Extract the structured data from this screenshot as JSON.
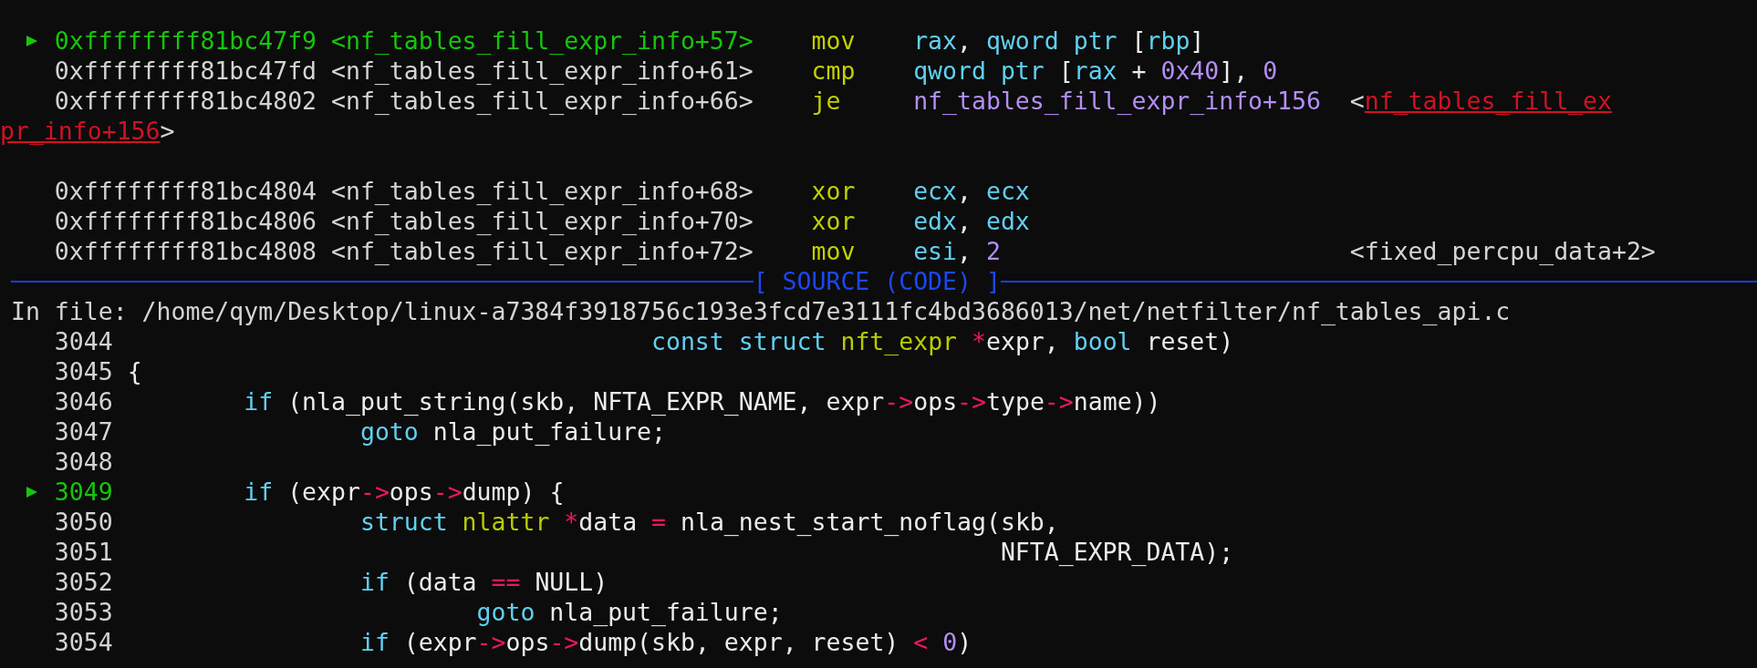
{
  "disassembly": [
    {
      "kind": "instr",
      "current": true,
      "address": "0xffffffff81bc47f9",
      "symbol": "<nf_tables_fill_expr_info+57>",
      "mnemonic": "mov",
      "operands": [
        {
          "kind": "reg",
          "text": "rax"
        },
        {
          "kind": "plain",
          "text": ", "
        },
        {
          "kind": "reg",
          "text": "qword ptr"
        },
        {
          "kind": "plain",
          "text": " ["
        },
        {
          "kind": "reg",
          "text": "rbp"
        },
        {
          "kind": "plain",
          "text": "]"
        }
      ]
    },
    {
      "kind": "instr",
      "current": false,
      "address": "0xffffffff81bc47fd",
      "symbol": "<nf_tables_fill_expr_info+61>",
      "mnemonic": "cmp",
      "operands": [
        {
          "kind": "reg",
          "text": "qword ptr"
        },
        {
          "kind": "plain",
          "text": " ["
        },
        {
          "kind": "reg",
          "text": "rax"
        },
        {
          "kind": "plain",
          "text": " + "
        },
        {
          "kind": "num",
          "text": "0x40"
        },
        {
          "kind": "plain",
          "text": "], "
        },
        {
          "kind": "num",
          "text": "0"
        }
      ]
    },
    {
      "kind": "instr",
      "current": false,
      "address": "0xffffffff81bc4802",
      "symbol": "<nf_tables_fill_expr_info+66>",
      "mnemonic": "je",
      "operands": [
        {
          "kind": "num",
          "text": "nf_tables_fill_expr_info+156"
        }
      ],
      "comment": {
        "kind": "link",
        "open": "<",
        "target": "nf_tables_fill_ex",
        "wrap": "pr_info+156",
        "close": ">"
      }
    },
    {
      "kind": "blank"
    },
    {
      "kind": "instr",
      "current": false,
      "address": "0xffffffff81bc4804",
      "symbol": "<nf_tables_fill_expr_info+68>",
      "mnemonic": "xor",
      "operands": [
        {
          "kind": "reg",
          "text": "ecx"
        },
        {
          "kind": "plain",
          "text": ", "
        },
        {
          "kind": "reg",
          "text": "ecx"
        }
      ]
    },
    {
      "kind": "instr",
      "current": false,
      "address": "0xffffffff81bc4806",
      "symbol": "<nf_tables_fill_expr_info+70>",
      "mnemonic": "xor",
      "operands": [
        {
          "kind": "reg",
          "text": "edx"
        },
        {
          "kind": "plain",
          "text": ", "
        },
        {
          "kind": "reg",
          "text": "edx"
        }
      ]
    },
    {
      "kind": "instr",
      "current": false,
      "address": "0xffffffff81bc4808",
      "symbol": "<nf_tables_fill_expr_info+72>",
      "mnemonic": "mov",
      "operands": [
        {
          "kind": "reg",
          "text": "esi"
        },
        {
          "kind": "plain",
          "text": ", "
        },
        {
          "kind": "num",
          "text": "2"
        }
      ],
      "comment": {
        "kind": "plain",
        "text": "<fixed_percpu_data+2>"
      }
    }
  ],
  "source": {
    "title": "[ SOURCE (CODE) ]",
    "file": "In file: /home/qym/Desktop/linux-a7384f3918756c193e3fcd7e3111fc4bd3686013/net/netfilter/nf_tables_api.c",
    "lines": [
      {
        "number": "3044",
        "current": false,
        "tokens": [
          {
            "kind": "kw",
            "text": "                                    const struct "
          },
          {
            "kind": "type",
            "text": "nft_expr "
          },
          {
            "kind": "op",
            "text": "*"
          },
          {
            "kind": "plain",
            "text": "expr, "
          },
          {
            "kind": "kw",
            "text": "bool"
          },
          {
            "kind": "plain",
            "text": " reset)"
          }
        ]
      },
      {
        "number": "3045",
        "current": false,
        "tokens": [
          {
            "kind": "plain",
            "text": "{"
          }
        ]
      },
      {
        "number": "3046",
        "current": false,
        "tokens": [
          {
            "kind": "kw",
            "text": "        if"
          },
          {
            "kind": "plain",
            "text": " (nla_put_string(skb, NFTA_EXPR_NAME, expr"
          },
          {
            "kind": "op",
            "text": "->"
          },
          {
            "kind": "plain",
            "text": "ops"
          },
          {
            "kind": "op",
            "text": "->"
          },
          {
            "kind": "plain",
            "text": "type"
          },
          {
            "kind": "op",
            "text": "->"
          },
          {
            "kind": "plain",
            "text": "name))"
          }
        ]
      },
      {
        "number": "3047",
        "current": false,
        "tokens": [
          {
            "kind": "kw",
            "text": "                goto"
          },
          {
            "kind": "plain",
            "text": " nla_put_failure;"
          }
        ]
      },
      {
        "number": "3048",
        "current": false
      },
      {
        "number": "3049",
        "current": true,
        "tokens": [
          {
            "kind": "kw",
            "text": "        if"
          },
          {
            "kind": "plain",
            "text": " (expr"
          },
          {
            "kind": "op",
            "text": "->"
          },
          {
            "kind": "plain",
            "text": "ops"
          },
          {
            "kind": "op",
            "text": "->"
          },
          {
            "kind": "plain",
            "text": "dump) {"
          }
        ]
      },
      {
        "number": "3050",
        "current": false,
        "tokens": [
          {
            "kind": "kw",
            "text": "                struct "
          },
          {
            "kind": "type",
            "text": "nlattr "
          },
          {
            "kind": "op",
            "text": "*"
          },
          {
            "kind": "plain",
            "text": "data "
          },
          {
            "kind": "op",
            "text": "="
          },
          {
            "kind": "plain",
            "text": " nla_nest_start_noflag(skb,"
          }
        ]
      },
      {
        "number": "3051",
        "current": false,
        "tokens": [
          {
            "kind": "plain",
            "text": "                                                            NFTA_EXPR_DATA);"
          }
        ]
      },
      {
        "number": "3052",
        "current": false,
        "tokens": [
          {
            "kind": "kw",
            "text": "                if"
          },
          {
            "kind": "plain",
            "text": " (data "
          },
          {
            "kind": "op",
            "text": "=="
          },
          {
            "kind": "plain",
            "text": " NULL)"
          }
        ]
      },
      {
        "number": "3053",
        "current": false,
        "tokens": [
          {
            "kind": "kw",
            "text": "                        goto"
          },
          {
            "kind": "plain",
            "text": " nla_put_failure;"
          }
        ]
      },
      {
        "number": "3054",
        "current": false,
        "tokens": [
          {
            "kind": "kw",
            "text": "                if"
          },
          {
            "kind": "plain",
            "text": " (expr"
          },
          {
            "kind": "op",
            "text": "->"
          },
          {
            "kind": "plain",
            "text": "ops"
          },
          {
            "kind": "op",
            "text": "->"
          },
          {
            "kind": "plain",
            "text": "dump(skb, expr, reset) "
          },
          {
            "kind": "op",
            "text": "< "
          },
          {
            "kind": "num",
            "text": "0"
          },
          {
            "kind": "plain",
            "text": ")"
          }
        ]
      }
    ]
  }
}
